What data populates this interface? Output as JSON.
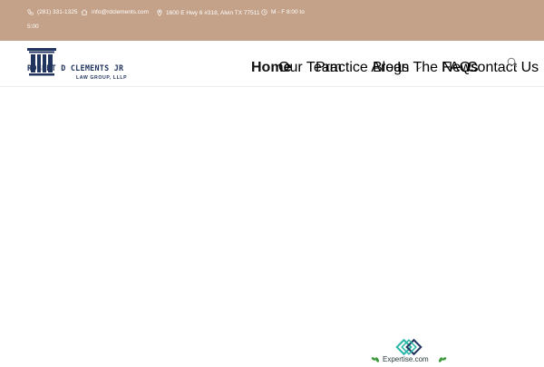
{
  "topbar": {
    "phone": "(281) 331-1325",
    "email": "info@rdclements.com",
    "address": "1600 E Hwy 6 #318, Alvin TX 77511",
    "hours_line1": "M - F 8:00 to",
    "hours_line2": "5:00"
  },
  "logo": {
    "name": "ROBERT D CLEMENTS JR",
    "subtitle": "LAW GROUP, LLLP"
  },
  "nav": {
    "items": [
      {
        "label": "Home"
      },
      {
        "label": "Our Team"
      },
      {
        "label": "Practice Areas"
      },
      {
        "label": "Blog"
      },
      {
        "label": "In The News"
      },
      {
        "label": "FAQs"
      },
      {
        "label": "Contact Us"
      }
    ]
  },
  "badge": {
    "label": "Expertise.com"
  },
  "colors": {
    "topbar_bg": "#c4a289",
    "brand_navy": "#21345e",
    "badge_teal": "#2bb5a7",
    "badge_green": "#3c9a3c"
  }
}
